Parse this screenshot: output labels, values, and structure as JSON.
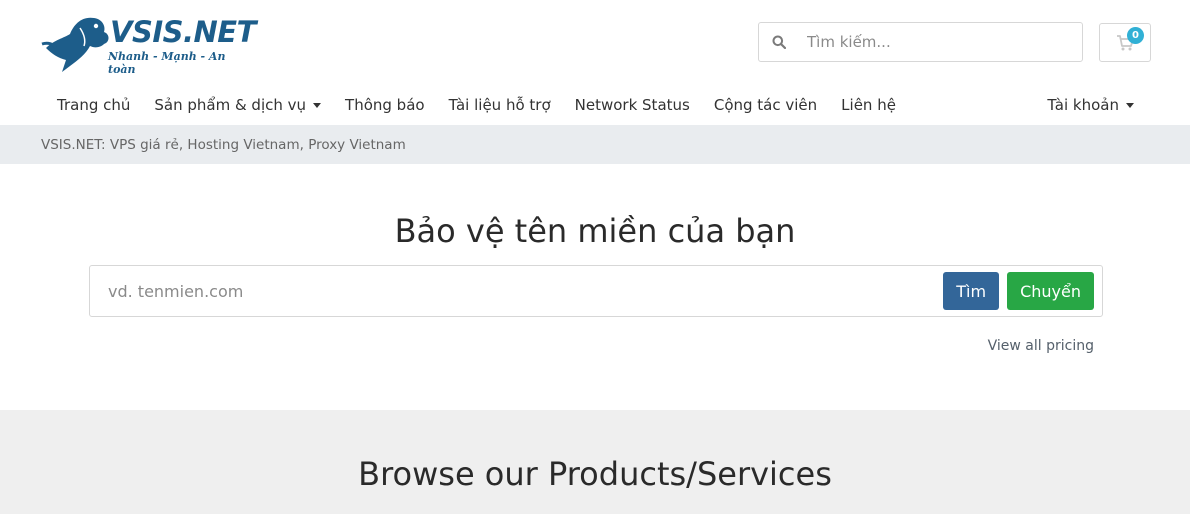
{
  "brand": {
    "name": "VSIS.NET",
    "tagline": "Nhanh - Mạnh - An toàn",
    "color": "#1d5d8a"
  },
  "search": {
    "placeholder": "Tìm kiếm...",
    "icon": "search-icon"
  },
  "cart": {
    "count": "0",
    "icon": "shopping-cart-icon"
  },
  "nav": {
    "items": [
      {
        "label": "Trang chủ"
      },
      {
        "label": "Sản phẩm & dịch vụ",
        "dropdown": true
      },
      {
        "label": "Thông báo"
      },
      {
        "label": "Tài liệu hỗ trợ"
      },
      {
        "label": "Network Status"
      },
      {
        "label": "Cộng tác viên"
      },
      {
        "label": "Liên hệ"
      }
    ],
    "account": "Tài khoản"
  },
  "breadcrumb": "VSIS.NET: VPS giá rẻ, Hosting Vietnam, Proxy Vietnam",
  "domain": {
    "title": "Bảo vệ tên miền của bạn",
    "placeholder": "vd. tenmien.com",
    "search_label": "Tìm",
    "transfer_label": "Chuyển",
    "pricing_link": "View all pricing"
  },
  "products": {
    "title": "Browse our Products/Services"
  },
  "colors": {
    "search_button": "#336699",
    "transfer_button": "#28a745",
    "badge": "#31b0d5",
    "breadcrumb_bg": "#e9ecef"
  }
}
